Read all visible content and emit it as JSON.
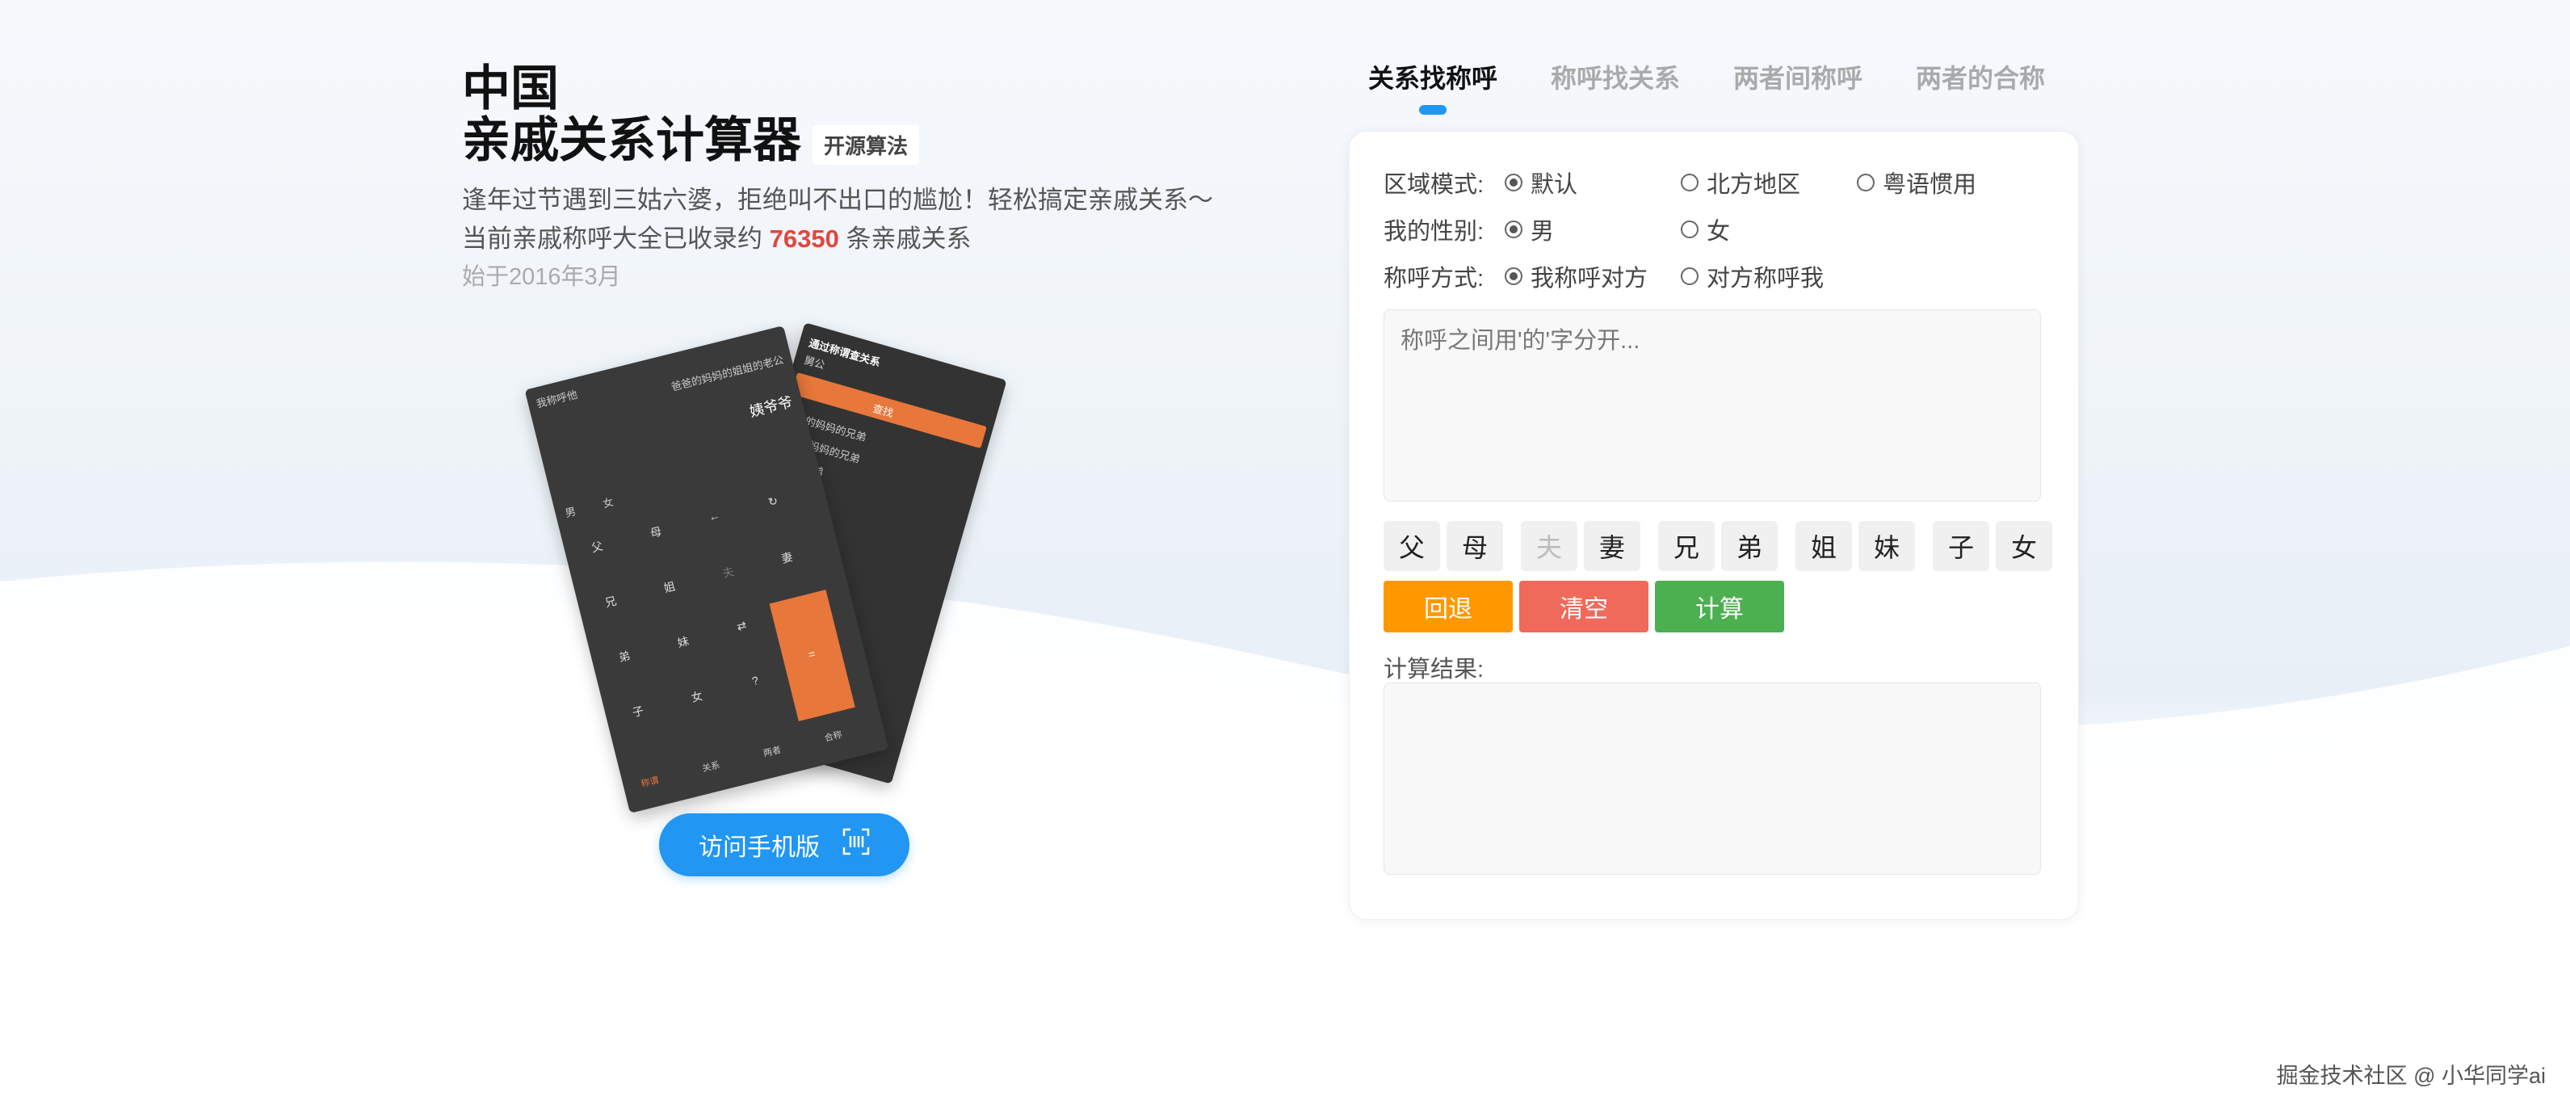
{
  "header": {
    "title_line1": "中国",
    "title_line2": "亲戚关系计算器",
    "badge": "开源算法",
    "desc_line1": "逢年过节遇到三姑六婆，拒绝叫不出口的尴尬！轻松搞定亲戚关系～",
    "desc_line2_prefix": "当前亲戚称呼大全已收录约",
    "count": "76350",
    "desc_line2_suffix": "条亲戚关系",
    "since": "始于2016年3月"
  },
  "phones": {
    "back_title": "通过称谓查关系",
    "back_input": "舅公",
    "back_button": "查找",
    "back_results": [
      "爸爸的妈妈的兄弟",
      "妈妈的妈妈的兄弟",
      "妈妈的兄弟"
    ],
    "front_title": "我称呼他",
    "front_expr": "爸爸的妈妈的姐姐的老公",
    "front_result": "姨爷爷",
    "front_gender_m": "男",
    "front_gender_f": "女",
    "front_keys": [
      "父",
      "母",
      "←",
      "↻",
      "兄",
      "姐",
      "夫",
      "妻",
      "弟",
      "妹",
      "⇄",
      "子",
      "女",
      "?"
    ],
    "front_eq": "=",
    "front_tabs": [
      "称谓",
      "关系",
      "两者",
      "合称"
    ]
  },
  "mobile_button": {
    "label": "访问手机版",
    "icon": "qrcode-scan-icon"
  },
  "tabs": [
    {
      "label": "关系找称呼",
      "active": true
    },
    {
      "label": "称呼找关系",
      "active": false
    },
    {
      "label": "两者间称呼",
      "active": false
    },
    {
      "label": "两者的合称",
      "active": false
    }
  ],
  "form": {
    "region": {
      "label": "区域模式:",
      "options": [
        {
          "label": "默认",
          "checked": true
        },
        {
          "label": "北方地区",
          "checked": false
        },
        {
          "label": "粤语惯用",
          "checked": false
        }
      ]
    },
    "gender": {
      "label": "我的性别:",
      "options": [
        {
          "label": "男",
          "checked": true
        },
        {
          "label": "女",
          "checked": false
        }
      ]
    },
    "mode": {
      "label": "称呼方式:",
      "options": [
        {
          "label": "我称呼对方",
          "checked": true
        },
        {
          "label": "对方称呼我",
          "checked": false
        }
      ]
    },
    "input_placeholder": "称呼之间用'的'字分开...",
    "keys": [
      {
        "label": "父",
        "disabled": false
      },
      {
        "label": "母",
        "disabled": false
      },
      {
        "label": "夫",
        "disabled": true
      },
      {
        "label": "妻",
        "disabled": false
      },
      {
        "label": "兄",
        "disabled": false
      },
      {
        "label": "弟",
        "disabled": false
      },
      {
        "label": "姐",
        "disabled": false
      },
      {
        "label": "妹",
        "disabled": false
      },
      {
        "label": "子",
        "disabled": false
      },
      {
        "label": "女",
        "disabled": false
      }
    ],
    "actions": [
      {
        "label": "回退",
        "color": "#ff9800"
      },
      {
        "label": "清空",
        "color": "#ef6a5a"
      },
      {
        "label": "计算",
        "color": "#4caf50"
      }
    ],
    "result_label": "计算结果:"
  },
  "footer": "掘金技术社区 @ 小华同学ai"
}
